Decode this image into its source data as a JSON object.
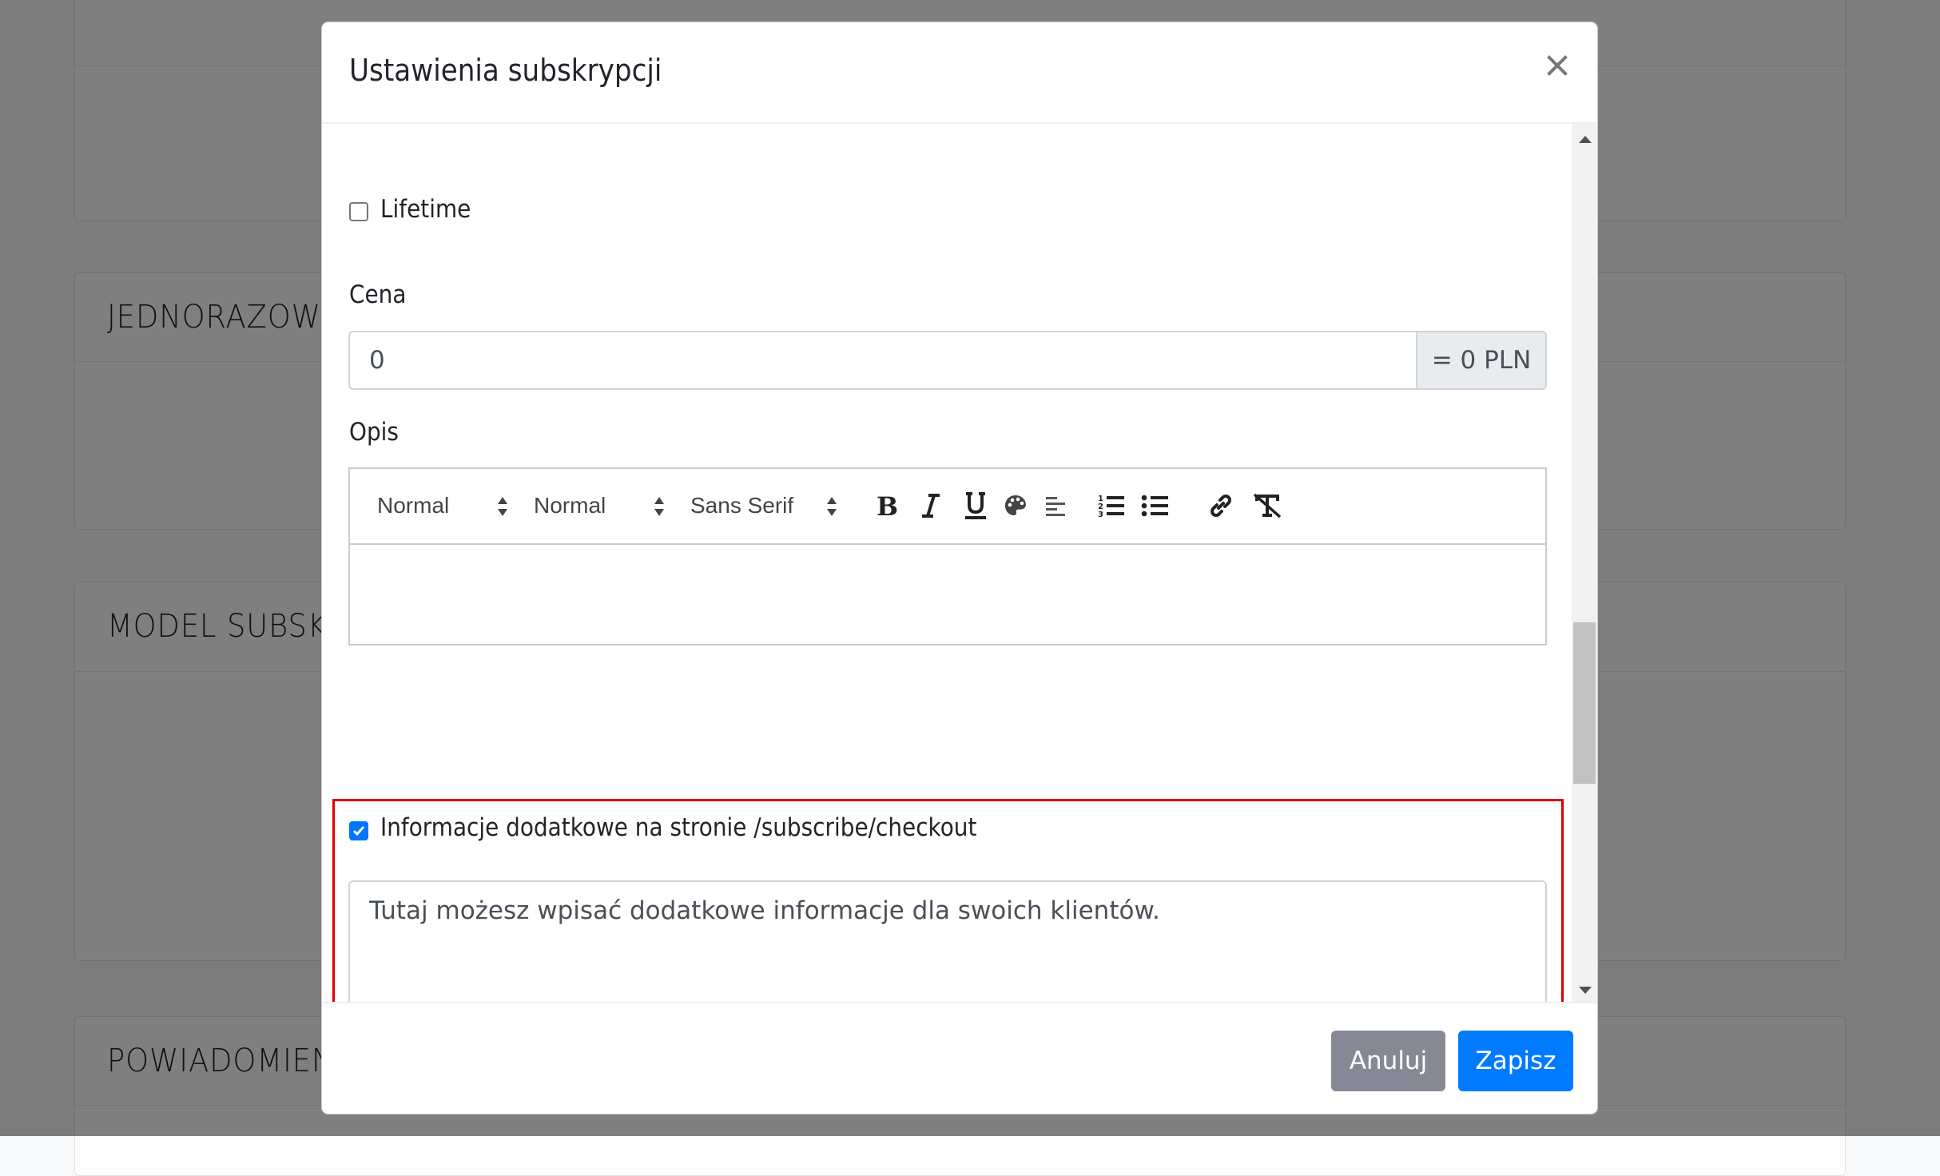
{
  "background": {
    "sections": [
      {
        "title": ""
      },
      {
        "title": "JEDNORAZOWE"
      },
      {
        "title": "MODEL SUBSKRYPCJI"
      },
      {
        "title": "POWIADOMIENIA"
      }
    ]
  },
  "modal": {
    "title": "Ustawienia subskrypcji",
    "close_icon": "×",
    "lifetime": {
      "label": "Lifetime",
      "checked": false
    },
    "price": {
      "label": "Cena",
      "value": "0",
      "addon": "= 0 PLN"
    },
    "description": {
      "label": "Opis",
      "toolbar": {
        "header_picker": "Normal",
        "size_picker": "Normal",
        "font_picker": "Sans Serif",
        "buttons": [
          "bold-icon",
          "italic-icon",
          "underline-icon",
          "color-palette-icon",
          "align-left-icon",
          "ordered-list-icon",
          "bullet-list-icon",
          "link-icon",
          "clear-format-icon"
        ]
      },
      "content": ""
    },
    "additional_info": {
      "label": "Informacje dodatkowe na stronie /subscribe/checkout",
      "checked": true,
      "text": "Tutaj możesz wpisać dodatkowe informacje dla swoich klientów.",
      "highlight_color": "#e00000"
    },
    "footer": {
      "cancel_label": "Anuluj",
      "save_label": "Zapisz"
    }
  },
  "colors": {
    "primary": "#007bff",
    "secondary": "#868895",
    "checkbox_checked": "#0075ff"
  }
}
